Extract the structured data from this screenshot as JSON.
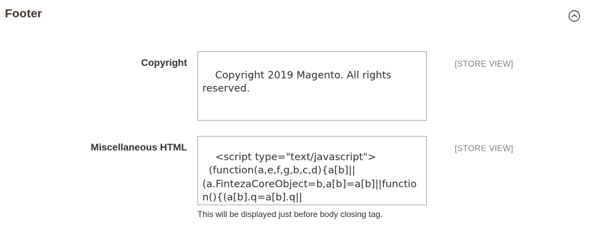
{
  "section": {
    "title": "Footer",
    "collapse_icon": "chevron-up-circle-icon"
  },
  "fields": {
    "copyright": {
      "label": "Copyright",
      "value": "Copyright 2019 Magento. All rights reserved.",
      "scope": "[STORE VIEW]"
    },
    "misc_html": {
      "label": "Miscellaneous HTML",
      "value": "<script type=\"text/javascript\">\n  (function(a,e,f,g,b,c,d){a[b]||(a.FintezaCoreObject=b,a[b]=a[b]||function(){(a[b].q=a[b].q||[]).push(arguments)},a[b].l=1*new Date,c=e.createElement",
      "scope": "[STORE VIEW]",
      "note": "This will be displayed just before body closing tag."
    }
  },
  "colors": {
    "title": "#41362f",
    "label": "#303030",
    "border": "#adadad",
    "scope": "#808080"
  }
}
